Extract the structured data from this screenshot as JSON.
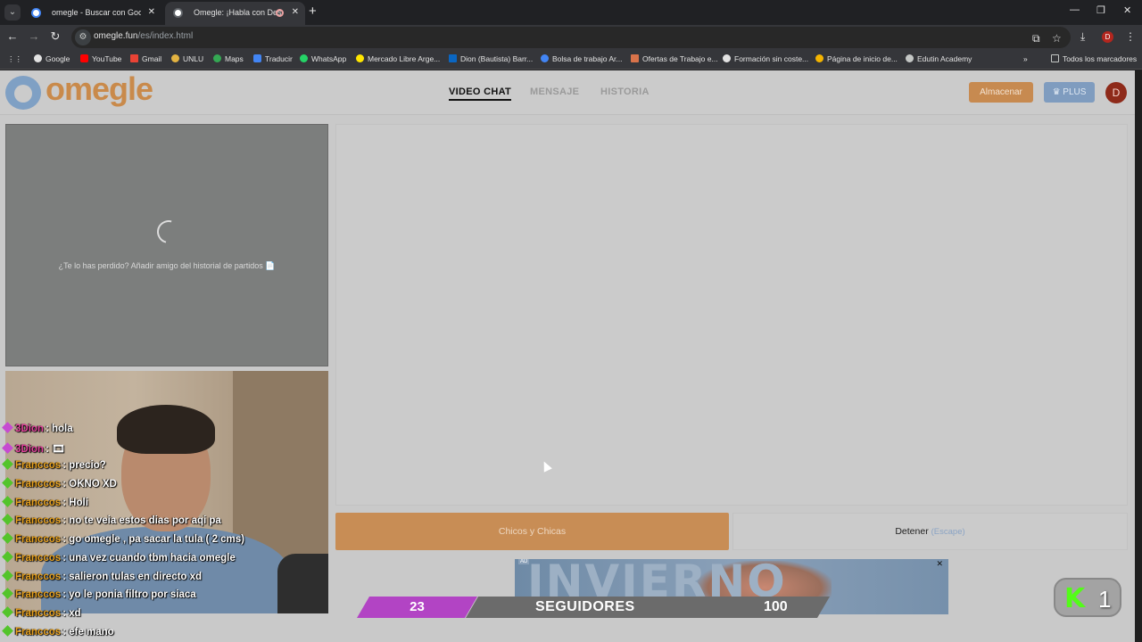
{
  "browser": {
    "tabs": [
      {
        "title": "omegle - Buscar con Google",
        "active": false
      },
      {
        "title": "Omegle: ¡Habla con Descon",
        "active": true
      }
    ],
    "url_host": "omegle.fun",
    "url_path": "/es/index.html",
    "profile_initial": "D",
    "bookmarks": [
      "Google",
      "YouTube",
      "Gmail",
      "UNLU",
      "Maps",
      "Traducir",
      "WhatsApp",
      "Mercado Libre Arge...",
      "Dion (Bautista) Barr...",
      "Bolsa de trabajo Ar...",
      "Ofertas de Trabajo e...",
      "Formación sin coste...",
      "Página de inicio de...",
      "Edutin Academy"
    ],
    "all_bookmarks": "Todos los marcadores"
  },
  "site": {
    "logo": "omegle",
    "nav": [
      "VIDEO CHAT",
      "MENSAJE",
      "HISTORIA"
    ],
    "store_button": "Almacenar",
    "plus_button": "♛ PLUS",
    "avatar_initial": "D",
    "missed_text": "¿Te lo has perdido? Añadir amigo del historial de partidos 📄",
    "match_button": "Chicos y Chicas",
    "stop_label": "Detener",
    "stop_hint": "(Escape)"
  },
  "chat": [
    {
      "user": "3Dion",
      "msg": ": hola",
      "alt": true
    },
    {
      "user": "3Dion",
      "msg": ": 🎞",
      "alt": true
    },
    {
      "user": "Franccos",
      "msg": ": precio?",
      "alt": false
    },
    {
      "user": "Franccos",
      "msg": ": OKNO XD",
      "alt": false
    },
    {
      "user": "Franccos",
      "msg": ": Holi",
      "alt": false
    },
    {
      "user": "Franccos",
      "msg": ": no te veia estos dias por aqi pa",
      "alt": false
    },
    {
      "user": "Franccos",
      "msg": ": go omegle , pa sacar la tula ( 2 cms)",
      "alt": false
    },
    {
      "user": "Franccos",
      "msg": ": una vez cuando tbm hacia omegle",
      "alt": false
    },
    {
      "user": "Franccos",
      "msg": ": salieron tulas en directo xd",
      "alt": false
    },
    {
      "user": "Franccos",
      "msg": ": yo le ponia filtro por siaca",
      "alt": false
    },
    {
      "user": "Franccos",
      "msg": ": xd",
      "alt": false
    },
    {
      "user": "Franccos",
      "msg": ": efe mano",
      "alt": false
    }
  ],
  "ad": {
    "text": "INVIERNO CORDOBES",
    "tag": "AD",
    "close": "✕"
  },
  "followers": {
    "current": "23",
    "label": "SEGUIDORES",
    "goal": "100"
  },
  "kick": {
    "logo": "K",
    "viewers": "1"
  },
  "colors": {
    "accent": "#c88d55",
    "plus": "#7f9cbf",
    "kick": "#53fc18",
    "follow_bar": "#b244c4"
  }
}
